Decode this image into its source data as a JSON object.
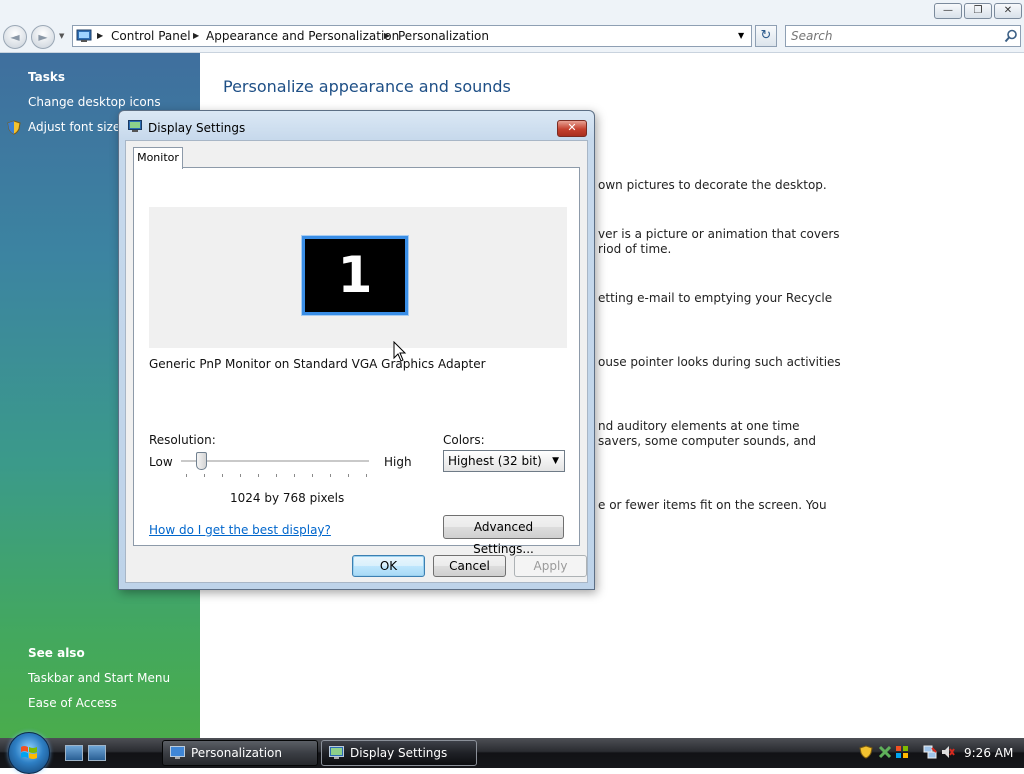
{
  "window": {
    "controls": {
      "minimize": "—",
      "maximize": "❐",
      "close": "✕"
    }
  },
  "addressbar": {
    "breadcrumbs": [
      "Control Panel",
      "Appearance and Personalization",
      "Personalization"
    ],
    "search_placeholder": "Search",
    "back_glyph": "◄",
    "forward_glyph": "►",
    "refresh_glyph": "↻"
  },
  "leftpane": {
    "tasks_heading": "Tasks",
    "tasks": [
      "Change desktop icons",
      "Adjust font size (DPI)"
    ],
    "see_also_heading": "See also",
    "see_also": [
      "Taskbar and Start Menu",
      "Ease of Access"
    ],
    "colors": {
      "top": "#3f6f9e",
      "bottom": "#4aac4c"
    }
  },
  "main": {
    "title": "Personalize appearance and sounds",
    "text_fragments": [
      "own pictures to decorate the desktop.",
      "ver is a picture or animation that covers",
      "riod of time.",
      "etting e-mail to emptying your Recycle",
      "ouse pointer looks during such activities",
      "nd auditory elements at one time",
      "savers, some computer sounds, and",
      "e or fewer items fit on the screen. You"
    ]
  },
  "dialog": {
    "title": "Display Settings",
    "close_glyph": "✕",
    "tab_label": "Monitor",
    "monitor_number": "1",
    "monitor_description": "Generic PnP Monitor on Standard VGA Graphics Adapter",
    "resolution_label": "Resolution:",
    "slider_low": "Low",
    "slider_high": "High",
    "slider_level": 0.1,
    "resolution_value": "1024 by 768 pixels",
    "colors_label": "Colors:",
    "colors_value": "Highest (32 bit)",
    "help_link": "How do I get the best display?",
    "advanced_button": "Advanced Settings...",
    "ok_button": "OK",
    "cancel_button": "Cancel",
    "apply_button": "Apply"
  },
  "taskbar": {
    "tasks": [
      {
        "label": "Personalization",
        "active": false
      },
      {
        "label": "Display Settings",
        "active": true
      }
    ],
    "clock": "9:26 AM"
  },
  "colors": {
    "accent": "#1e4f86",
    "link": "#0066cc",
    "monitor_highlight": "#3a8ee6"
  }
}
